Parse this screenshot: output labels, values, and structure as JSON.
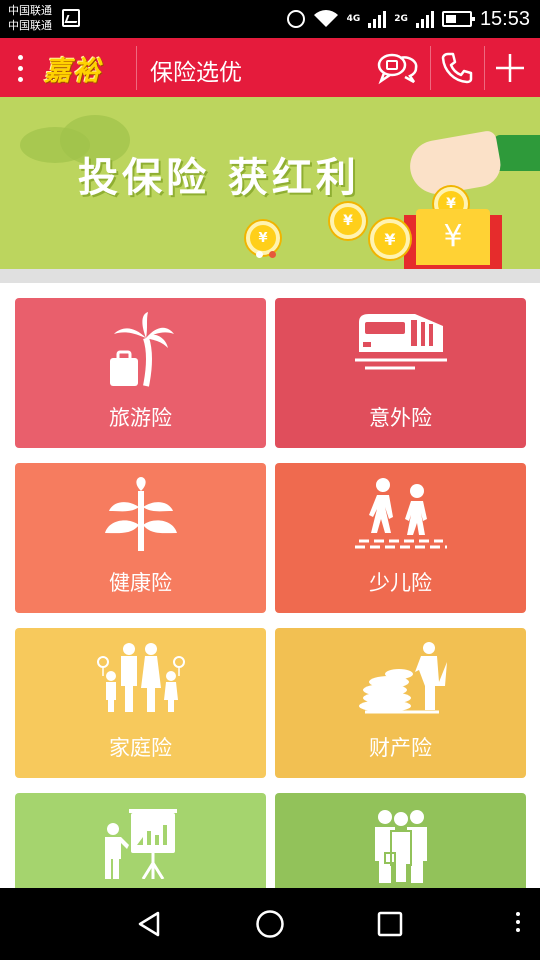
{
  "status_bar": {
    "carrier_1": "中国联通",
    "carrier_2": "中国联通",
    "net_1": "4G",
    "net_2": "2G",
    "time": "15:53"
  },
  "header": {
    "logo": "嘉裕",
    "title": "保险选优",
    "icons": [
      "menu-icon",
      "chat-icon",
      "phone-icon",
      "plus-icon"
    ],
    "bg_color": "#e51b3c"
  },
  "banner": {
    "headline": "投保险 获红利",
    "currency_symbol": "¥",
    "slide_count": 2,
    "active_slide": 2
  },
  "categories": [
    {
      "label": "旅游险",
      "icon": "palm-suitcase-icon",
      "color": "#e95f6c"
    },
    {
      "label": "意外险",
      "icon": "train-icon",
      "color": "#e04e5c"
    },
    {
      "label": "健康险",
      "icon": "plant-icon",
      "color": "#f67c5f"
    },
    {
      "label": "少儿险",
      "icon": "children-walking-icon",
      "color": "#ef6a4f"
    },
    {
      "label": "家庭险",
      "icon": "family-icon",
      "color": "#f7c95c"
    },
    {
      "label": "财产险",
      "icon": "money-stack-icon",
      "color": "#f2c052"
    },
    {
      "label": "",
      "icon": "presentation-icon",
      "color": "#a5d46e"
    },
    {
      "label": "",
      "icon": "business-group-icon",
      "color": "#92c25a"
    }
  ],
  "nav_bar": {
    "buttons": [
      "back-icon",
      "home-icon",
      "recents-icon",
      "more-icon"
    ]
  }
}
